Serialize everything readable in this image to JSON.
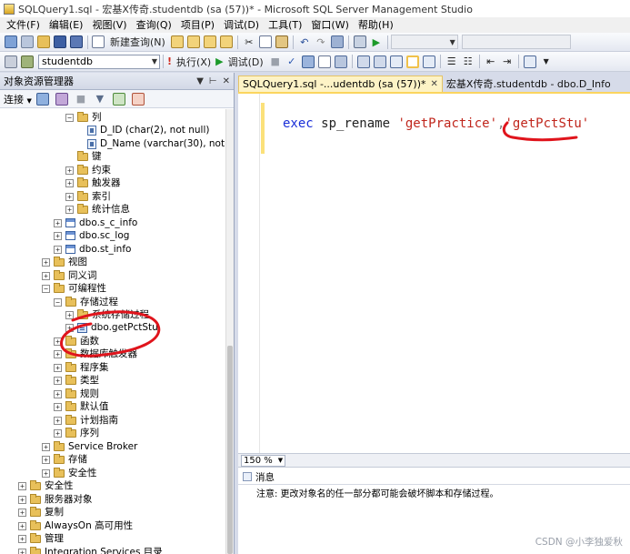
{
  "window": {
    "title": "SQLQuery1.sql - 宏基X传奇.studentdb (sa (57))* - Microsoft SQL Server Management Studio"
  },
  "menu": [
    "文件(F)",
    "编辑(E)",
    "视图(V)",
    "查询(Q)",
    "项目(P)",
    "调试(D)",
    "工具(T)",
    "窗口(W)",
    "帮助(H)"
  ],
  "toolbar1": {
    "new_query_label": "新建查询(N)"
  },
  "toolbar2": {
    "database": "studentdb",
    "execute_label": "执行(X)",
    "debug_label": "调试(D)"
  },
  "object_explorer": {
    "title": "对象资源管理器",
    "connect_label": "连接",
    "tree": {
      "columns_folder": "列",
      "col_d_id": "D_ID (char(2), not null)",
      "col_d_name": "D_Name (varchar(30), not nu",
      "keys": "键",
      "constraints": "约束",
      "triggers": "触发器",
      "indexes": "索引",
      "statistics": "统计信息",
      "table_s_c_info": "dbo.s_c_info",
      "table_sc_log": "dbo.sc_log",
      "table_st_info": "dbo.st_info",
      "views": "视图",
      "synonyms": "同义词",
      "programmability": "可编程性",
      "stored_procedures": "存储过程",
      "system_stored_procedures": "系统存储过程",
      "proc_getpctstu": "dbo.getPctStu",
      "functions": "函数",
      "db_triggers": "数据库触发器",
      "assemblies": "程序集",
      "types": "类型",
      "rules": "规则",
      "defaults": "默认值",
      "plan_guides": "计划指南",
      "sequences": "序列",
      "service_broker": "Service Broker",
      "storage": "存储",
      "db_security": "安全性",
      "security": "安全性",
      "server_objects": "服务器对象",
      "replication": "复制",
      "alwayson": "AlwaysOn 高可用性",
      "management": "管理",
      "integration_services": "Integration Services 目录"
    }
  },
  "editor": {
    "tabs": [
      {
        "label": "SQLQuery1.sql -...udentdb (sa (57))*"
      },
      {
        "label": "宏基X传奇.studentdb - dbo.D_Info"
      }
    ],
    "code": {
      "keyword": "exec",
      "proc": "sp_rename",
      "arg1": "'getPractice'",
      "comma": ",",
      "arg2": "'getPctStu'"
    },
    "zoom": "150 %"
  },
  "messages": {
    "tab_label": "消息",
    "text": "注意: 更改对象名的任一部分都可能会破坏脚本和存储过程。"
  },
  "watermark": "CSDN @小李独爱秋",
  "colors": {
    "keyword": "#1a2fd8",
    "string": "#c0261c",
    "annotation": "#e0141c",
    "active_tab": "#fdf3c6"
  }
}
